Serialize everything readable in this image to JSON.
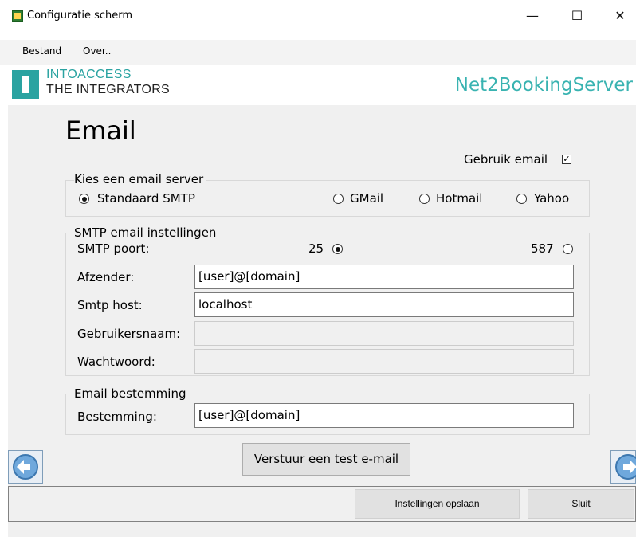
{
  "window": {
    "title": "Configuratie scherm",
    "icon": "spreadsheet-app-icon",
    "controls": {
      "minimize": "—",
      "maximize": "☐",
      "close": "✕"
    }
  },
  "menu": {
    "items": [
      "Bestand",
      "Over.."
    ]
  },
  "header": {
    "logo_line1": "INTOACCESS",
    "logo_line2": "THE INTEGRATORS",
    "product": "Net2BookingServer",
    "accent_color": "#2aa3a1"
  },
  "page": {
    "title": "Email",
    "use_email_label": "Gebruik email",
    "use_email_checked": true
  },
  "server_group": {
    "title": "Kies een email server",
    "options": [
      {
        "label": "Standaard SMTP",
        "checked": true
      },
      {
        "label": "GMail",
        "checked": false
      },
      {
        "label": "Hotmail",
        "checked": false
      },
      {
        "label": "Yahoo",
        "checked": false
      }
    ]
  },
  "smtp_group": {
    "title": "SMTP email instellingen",
    "port_label": "SMTP poort:",
    "port_options": [
      {
        "label": "25",
        "checked": true
      },
      {
        "label": "587",
        "checked": false
      }
    ],
    "sender_label": "Afzender:",
    "sender_value": "[user]@[domain]",
    "host_label": "Smtp host:",
    "host_value": "localhost",
    "username_label": "Gebruikersnaam:",
    "username_value": "",
    "password_label": "Wachtwoord:",
    "password_value": ""
  },
  "destination_group": {
    "title": "Email bestemming",
    "label": "Bestemming:",
    "value": "[user]@[domain]"
  },
  "actions": {
    "test_email": "Verstuur een test e-mail",
    "save": "Instellingen opslaan",
    "close": "Sluit"
  },
  "navigation": {
    "prev_icon": "arrow-left-icon",
    "next_icon": "arrow-right-icon"
  }
}
